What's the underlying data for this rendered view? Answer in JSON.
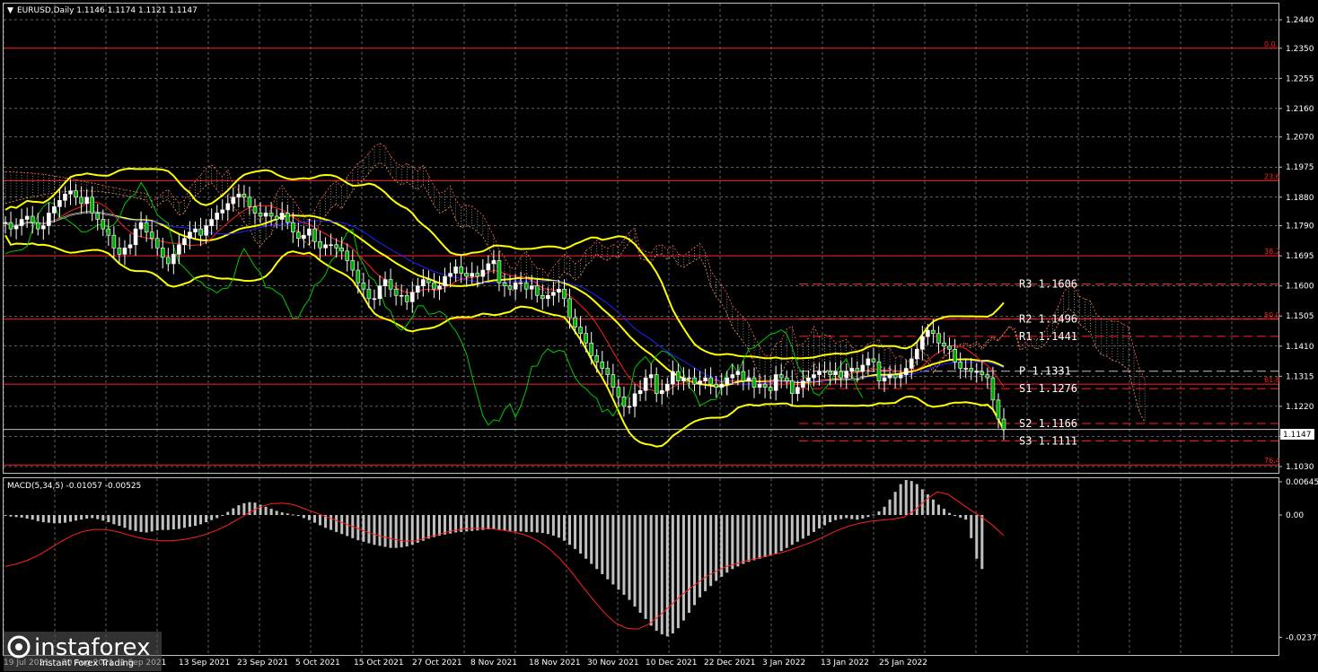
{
  "window": {
    "header": "EURUSD,Daily  1.1146 1.1174 1.1121 1.1147",
    "macd_header": "MACD(5,34,5) -0.01057 -0.00525",
    "current_price": "1.1147"
  },
  "watermark": {
    "logo": "instaforex",
    "subtitle": "Instant Forex Trading"
  },
  "colors": {
    "background": "#000000",
    "grid": "#c0c0c0",
    "bull_candle": "#ffffff",
    "bear_candle": "#00aa00",
    "bollinger": "#ffff00",
    "tenkan": "#ff2020",
    "kijun": "#2020ff",
    "chikou": "#00c800",
    "levels": "#ff2020",
    "macd_hist": "#c0c0c0",
    "macd_signal": "#ff2020"
  },
  "chart_data": [
    {
      "type": "candlestick",
      "symbol": "EURUSD",
      "timeframe": "Daily",
      "ohlc_last": {
        "open": 1.1146,
        "high": 1.1174,
        "low": 1.1121,
        "close": 1.1147
      },
      "y_ticks": [
        "1.2440",
        "1.2350",
        "1.2255",
        "1.2160",
        "1.2070",
        "1.1975",
        "1.1880",
        "1.1790",
        "1.1695",
        "1.1600",
        "1.1505",
        "1.1410",
        "1.1315",
        "1.1220",
        "1.1125",
        "1.1030"
      ],
      "ylim": [
        1.1025,
        1.247
      ],
      "x_ticks": [
        "19 Jul 2021",
        "20 Aug 2021",
        "1 Sep 2021",
        "13 Sep 2021",
        "23 Sep 2021",
        "5 Oct 2021",
        "15 Oct 2021",
        "27 Oct 2021",
        "8 Nov 2021",
        "18 Nov 2021",
        "30 Nov 2021",
        "10 Dec 2021",
        "22 Dec 2021",
        "3 Jan 2022",
        "13 Jan 2022",
        "25 Jan 2022"
      ],
      "close": [
        1.18,
        1.178,
        1.179,
        1.181,
        1.182,
        1.18,
        1.178,
        1.179,
        1.183,
        1.185,
        1.187,
        1.189,
        1.19,
        1.188,
        1.186,
        1.188,
        1.183,
        1.181,
        1.178,
        1.176,
        1.172,
        1.17,
        1.172,
        1.173,
        1.178,
        1.18,
        1.177,
        1.175,
        1.172,
        1.169,
        1.167,
        1.17,
        1.173,
        1.175,
        1.177,
        1.178,
        1.176,
        1.179,
        1.181,
        1.183,
        1.184,
        1.186,
        1.188,
        1.189,
        1.188,
        1.185,
        1.183,
        1.182,
        1.183,
        1.182,
        1.181,
        1.183,
        1.18,
        1.177,
        1.175,
        1.176,
        1.178,
        1.174,
        1.172,
        1.173,
        1.173,
        1.172,
        1.171,
        1.168,
        1.165,
        1.161,
        1.159,
        1.156,
        1.156,
        1.16,
        1.162,
        1.159,
        1.157,
        1.157,
        1.155,
        1.158,
        1.16,
        1.162,
        1.161,
        1.159,
        1.16,
        1.163,
        1.164,
        1.166,
        1.164,
        1.163,
        1.164,
        1.163,
        1.165,
        1.167,
        1.168,
        1.161,
        1.16,
        1.159,
        1.161,
        1.161,
        1.159,
        1.16,
        1.157,
        1.156,
        1.157,
        1.158,
        1.159,
        1.156,
        1.15,
        1.147,
        1.145,
        1.142,
        1.138,
        1.136,
        1.134,
        1.132,
        1.128,
        1.125,
        1.122,
        1.122,
        1.126,
        1.127,
        1.131,
        1.132,
        1.126,
        1.127,
        1.129,
        1.133,
        1.13,
        1.131,
        1.131,
        1.129,
        1.13,
        1.131,
        1.129,
        1.128,
        1.129,
        1.131,
        1.132,
        1.133,
        1.13,
        1.131,
        1.128,
        1.129,
        1.128,
        1.127,
        1.132,
        1.131,
        1.13,
        1.126,
        1.128,
        1.13,
        1.131,
        1.132,
        1.133,
        1.133,
        1.132,
        1.133,
        1.131,
        1.133,
        1.134,
        1.133,
        1.135,
        1.137,
        1.136,
        1.13,
        1.131,
        1.132,
        1.131,
        1.132,
        1.134,
        1.137,
        1.14,
        1.144,
        1.146,
        1.145,
        1.142,
        1.141,
        1.14,
        1.136,
        1.134,
        1.134,
        1.133,
        1.133,
        1.132,
        1.131,
        1.124,
        1.118,
        1.1147
      ],
      "bollinger": {
        "upper_approx": [
          1.195,
          1.19,
          1.192,
          1.19,
          1.192,
          1.19,
          1.175,
          1.174,
          1.173,
          1.16,
          1.158,
          1.158,
          1.154,
          1.15,
          1.17,
          1.17,
          1.14,
          1.134,
          1.134,
          1.134,
          1.135,
          1.135,
          1.142,
          1.146,
          1.143,
          1.135
        ],
        "lower_approx": [
          1.175,
          1.168,
          1.168,
          1.17,
          1.172,
          1.17,
          1.154,
          1.148,
          1.15,
          1.155,
          1.156,
          1.148,
          1.135,
          1.115,
          1.115,
          1.123,
          1.125,
          1.126,
          1.126,
          1.125,
          1.127,
          1.127,
          1.126,
          1.127,
          1.127,
          1.114
        ]
      },
      "levels": [
        {
          "label": "0.0",
          "price": 1.235
        },
        {
          "label": "23.6",
          "price": 1.1932
        },
        {
          "label": "38.2",
          "price": 1.1695
        },
        {
          "label": "50.0",
          "price": 1.1495
        },
        {
          "label": "61.8",
          "price": 1.129
        },
        {
          "label": "76.4",
          "price": 1.1035
        }
      ],
      "pivots": [
        {
          "label": "R3 1.1606",
          "price": 1.1606
        },
        {
          "label": "R2 1.1496",
          "price": 1.1496
        },
        {
          "label": "R1 1.1441",
          "price": 1.1441
        },
        {
          "label": "P  1.1331",
          "price": 1.1331
        },
        {
          "label": "S1 1.1276",
          "price": 1.1276
        },
        {
          "label": "S2 1.1166",
          "price": 1.1166
        },
        {
          "label": "S3 1.1111",
          "price": 1.1111
        }
      ]
    },
    {
      "type": "bar",
      "name": "MACD(5,34,5)",
      "values_label": [
        "-0.01057",
        "-0.00525"
      ],
      "y_ticks": [
        "0.00645",
        "0.00",
        "-0.02377"
      ],
      "ylim": [
        -0.02377,
        0.00645
      ],
      "histogram": [
        -0.0001,
        -0.0003,
        -0.0004,
        -0.0005,
        -0.0007,
        -0.0009,
        -0.0012,
        -0.0014,
        -0.0015,
        -0.0016,
        -0.0016,
        -0.0015,
        -0.0013,
        -0.0011,
        -0.0009,
        -0.0007,
        -0.0006,
        -0.0008,
        -0.0011,
        -0.0014,
        -0.0018,
        -0.0021,
        -0.0025,
        -0.0029,
        -0.0031,
        -0.0033,
        -0.0034,
        -0.0032,
        -0.003,
        -0.0029,
        -0.0029,
        -0.0028,
        -0.0027,
        -0.0025,
        -0.0023,
        -0.0021,
        -0.0018,
        -0.0014,
        -0.001,
        -0.0006,
        -0.0001,
        0.0006,
        0.0013,
        0.0019,
        0.0023,
        0.0025,
        0.0024,
        0.002,
        0.0016,
        0.0012,
        0.0008,
        0.0005,
        0.0003,
        0.0001,
        -0.0002,
        -0.0006,
        -0.001,
        -0.0015,
        -0.002,
        -0.0025,
        -0.0029,
        -0.0033,
        -0.0037,
        -0.0041,
        -0.0045,
        -0.0049,
        -0.0052,
        -0.0055,
        -0.0058,
        -0.006,
        -0.0062,
        -0.0064,
        -0.0064,
        -0.0063,
        -0.0061,
        -0.0058,
        -0.0054,
        -0.005,
        -0.0046,
        -0.0043,
        -0.004,
        -0.0038,
        -0.0036,
        -0.0034,
        -0.0033,
        -0.0032,
        -0.0031,
        -0.003,
        -0.0029,
        -0.0028,
        -0.0028,
        -0.0029,
        -0.003,
        -0.0031,
        -0.0032,
        -0.0032,
        -0.0033,
        -0.0033,
        -0.0034,
        -0.0035,
        -0.0037,
        -0.004,
        -0.0044,
        -0.005,
        -0.0058,
        -0.0066,
        -0.0075,
        -0.0085,
        -0.0095,
        -0.0105,
        -0.0115,
        -0.0125,
        -0.0135,
        -0.0145,
        -0.0155,
        -0.0165,
        -0.0178,
        -0.019,
        -0.0202,
        -0.0215,
        -0.0225,
        -0.0232,
        -0.0236,
        -0.023,
        -0.022,
        -0.0205,
        -0.019,
        -0.0175,
        -0.016,
        -0.0148,
        -0.0138,
        -0.0128,
        -0.012,
        -0.0112,
        -0.0105,
        -0.01,
        -0.0095,
        -0.0091,
        -0.0088,
        -0.0085,
        -0.0082,
        -0.0079,
        -0.0075,
        -0.007,
        -0.0064,
        -0.0058,
        -0.0052,
        -0.0046,
        -0.004,
        -0.0033,
        -0.0026,
        -0.002,
        -0.0014,
        -0.001,
        -0.0008,
        -0.0006,
        -0.0008,
        -0.0009,
        -0.0007,
        -0.0004,
        0.0001,
        0.0007,
        0.0016,
        0.003,
        0.0045,
        0.006,
        0.0068,
        0.0066,
        0.006,
        0.005,
        0.004,
        0.003,
        0.002,
        0.0012,
        0.0004,
        -0.0002,
        -0.0005,
        -0.0009,
        -0.0045,
        -0.0085,
        -0.0105
      ],
      "signal": [
        -0.01,
        -0.0095,
        -0.0088,
        -0.0078,
        -0.0065,
        -0.0052,
        -0.004,
        -0.0032,
        -0.0028,
        -0.0028,
        -0.0032,
        -0.0038,
        -0.0044,
        -0.0048,
        -0.005,
        -0.005,
        -0.0048,
        -0.0044,
        -0.0038,
        -0.003,
        -0.002,
        -0.0008,
        0.0005,
        0.0016,
        0.0022,
        0.0023,
        0.002,
        0.0012,
        0.0004,
        -0.0004,
        -0.0012,
        -0.002,
        -0.0028,
        -0.0036,
        -0.0042,
        -0.0047,
        -0.0051,
        -0.005,
        -0.0044,
        -0.0038,
        -0.0032,
        -0.0028,
        -0.0026,
        -0.0026,
        -0.0027,
        -0.003,
        -0.0034,
        -0.004,
        -0.005,
        -0.0065,
        -0.0085,
        -0.011,
        -0.0138,
        -0.0165,
        -0.019,
        -0.021,
        -0.022,
        -0.0222,
        -0.0212,
        -0.0195,
        -0.0175,
        -0.0155,
        -0.0138,
        -0.0122,
        -0.011,
        -0.01,
        -0.0094,
        -0.0088,
        -0.0083,
        -0.0078,
        -0.0073,
        -0.0066,
        -0.0058,
        -0.005,
        -0.004,
        -0.003,
        -0.0022,
        -0.0016,
        -0.0012,
        -0.001,
        -0.0008,
        -0.0004,
        0.001,
        0.003,
        0.0045,
        0.004,
        0.0025,
        0.001,
        -0.0004,
        -0.002,
        -0.004
      ]
    }
  ]
}
